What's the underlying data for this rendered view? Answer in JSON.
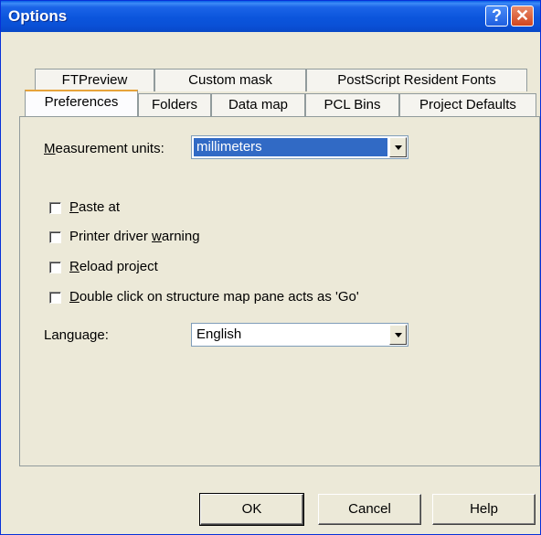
{
  "window": {
    "title": "Options",
    "help_glyph": "?",
    "close_glyph": "✕"
  },
  "tabs_row1": [
    {
      "label": "FTPreview"
    },
    {
      "label": "Custom mask"
    },
    {
      "label": "PostScript Resident Fonts"
    }
  ],
  "tabs_row2": [
    {
      "label": "Preferences",
      "selected": true
    },
    {
      "label": "Folders"
    },
    {
      "label": "Data map"
    },
    {
      "label": "PCL Bins"
    },
    {
      "label": "Project Defaults"
    }
  ],
  "measurement": {
    "label_first": "M",
    "label_rest": "easurement units:",
    "value": "millimeters"
  },
  "checkboxes": [
    {
      "u": "P",
      "rest": "aste at",
      "pre": "",
      "checked": false
    },
    {
      "pre": "Printer driver ",
      "u": "w",
      "rest": "arning",
      "checked": false
    },
    {
      "u": "R",
      "rest": "eload project",
      "pre": "",
      "checked": false
    },
    {
      "u": "D",
      "rest": "ouble click on structure map pane acts as 'Go'",
      "pre": "",
      "checked": false
    }
  ],
  "language": {
    "label": "Language:",
    "value": "English"
  },
  "buttons": {
    "ok": "OK",
    "cancel": "Cancel",
    "help": "Help"
  },
  "colors": {
    "selection": "#316ac5",
    "titlebar": "#0a55dc"
  }
}
